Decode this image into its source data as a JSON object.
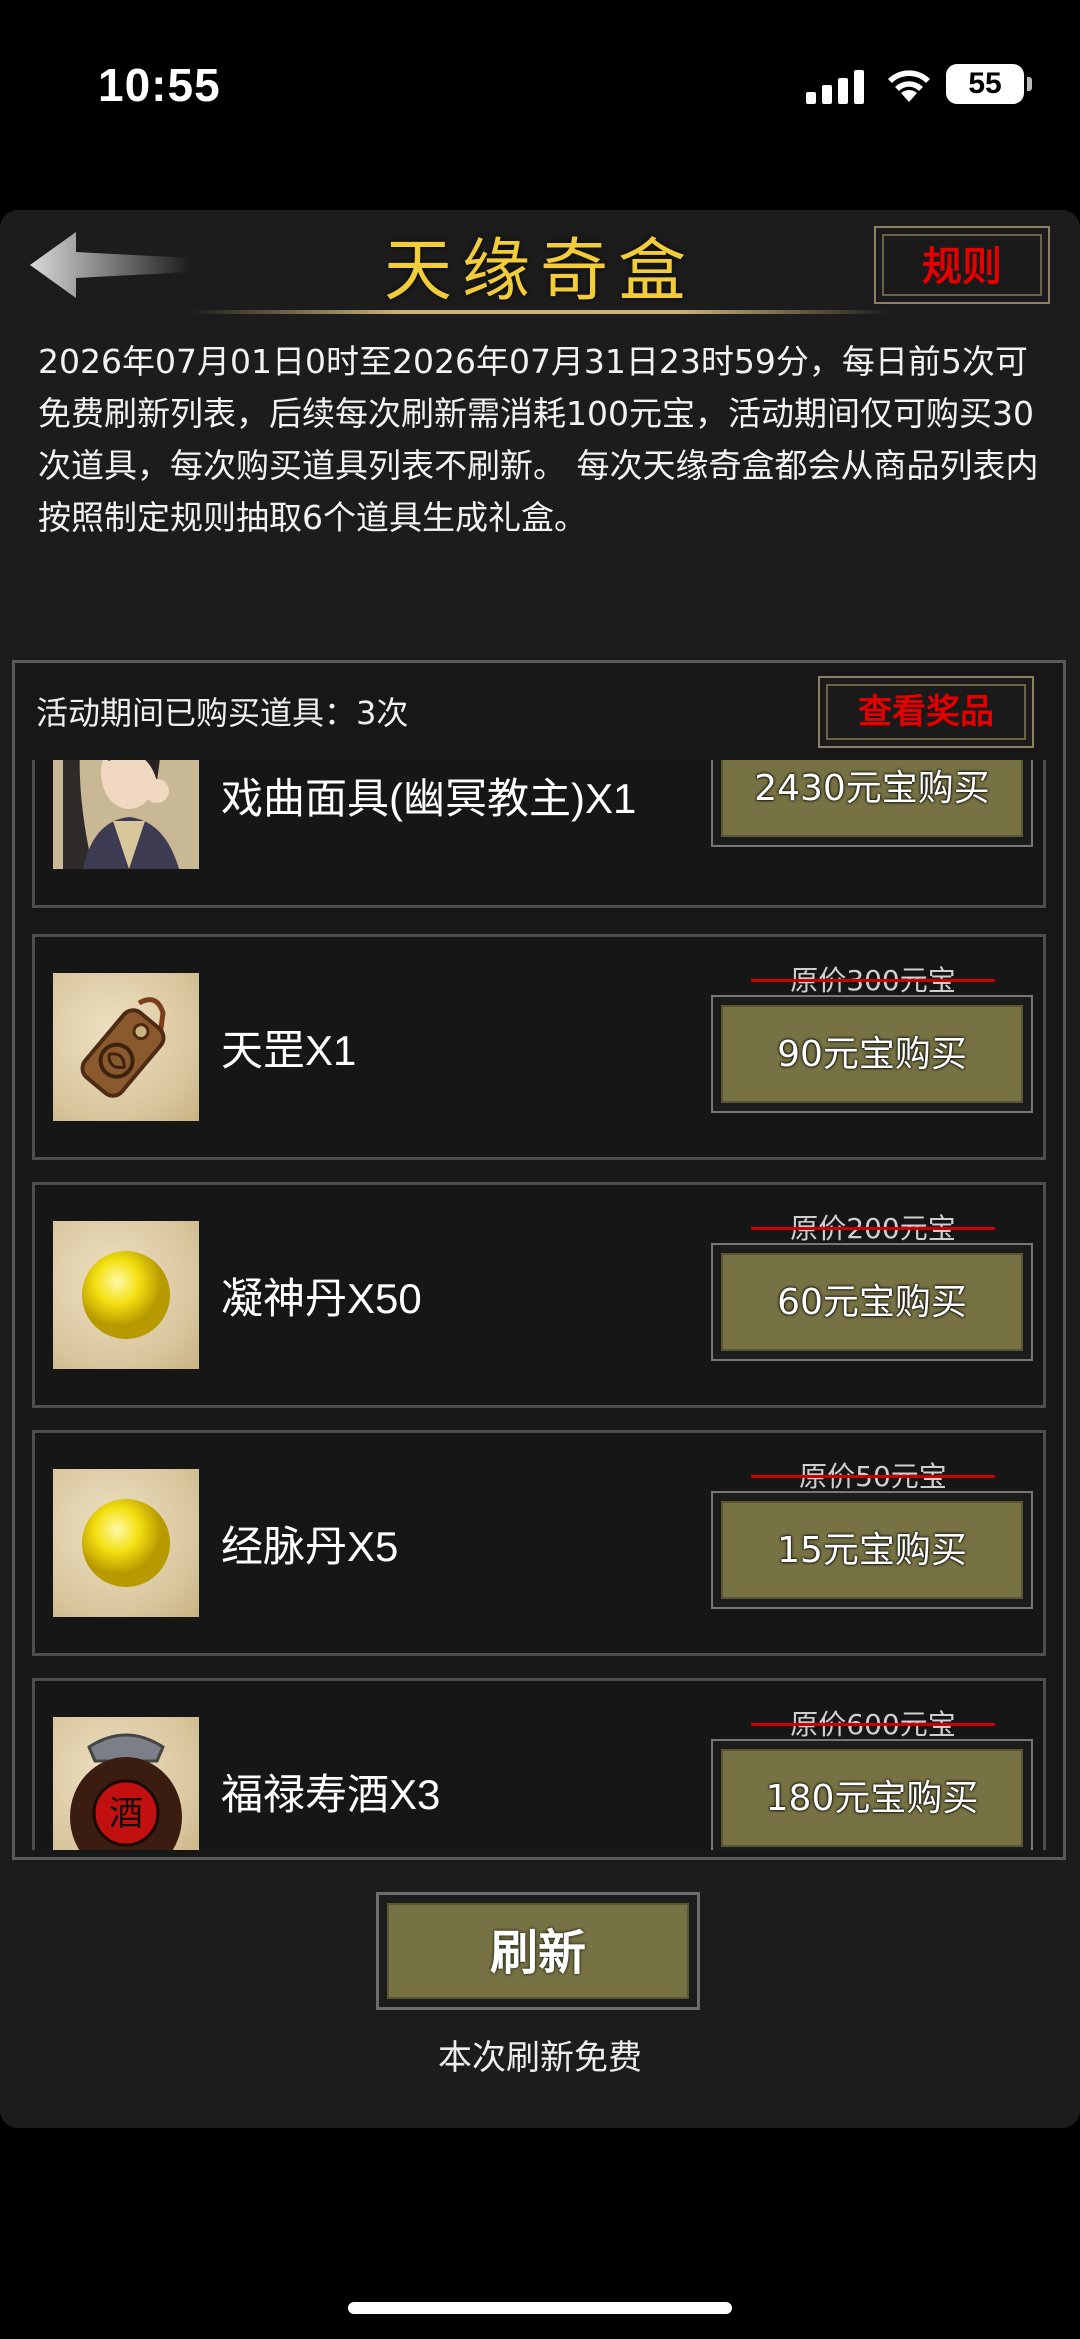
{
  "status_bar": {
    "time": "10:55",
    "battery": "55"
  },
  "header": {
    "title": "天缘奇盒",
    "rules_label": "规则"
  },
  "description": "2026年07月01日0时至2026年07月31日23时59分，每日前5次可免费刷新列表，后续每次刷新需消耗100元宝，活动期间仅可购买30次道具，每次购买道具列表不刷新。 每次天缘奇盒都会从商品列表内按照制定规则抽取6个道具生成礼盒。",
  "purchase_count": "活动期间已购买道具：3次",
  "view_prizes_label": "查看奖品",
  "items": [
    {
      "name": "戏曲面具(幽冥教主)X1",
      "original": "",
      "buy": "2430元宝购买",
      "icon": "character-portrait-icon"
    },
    {
      "name": "天罡X1",
      "original": "原价300元宝",
      "buy": "90元宝购买",
      "icon": "bronze-token-icon"
    },
    {
      "name": "凝神丹X50",
      "original": "原价200元宝",
      "buy": "60元宝购买",
      "icon": "golden-pill-icon"
    },
    {
      "name": "经脉丹X5",
      "original": "原价50元宝",
      "buy": "15元宝购买",
      "icon": "golden-pill-icon"
    },
    {
      "name": "福禄寿酒X3",
      "original": "原价600元宝",
      "buy": "180元宝购买",
      "icon": "wine-jar-icon"
    }
  ],
  "refresh_label": "刷新",
  "refresh_note": "本次刷新免费",
  "colors": {
    "title": "#f2cc3a",
    "accent_red": "#e30000",
    "button_olive": "#767244"
  }
}
